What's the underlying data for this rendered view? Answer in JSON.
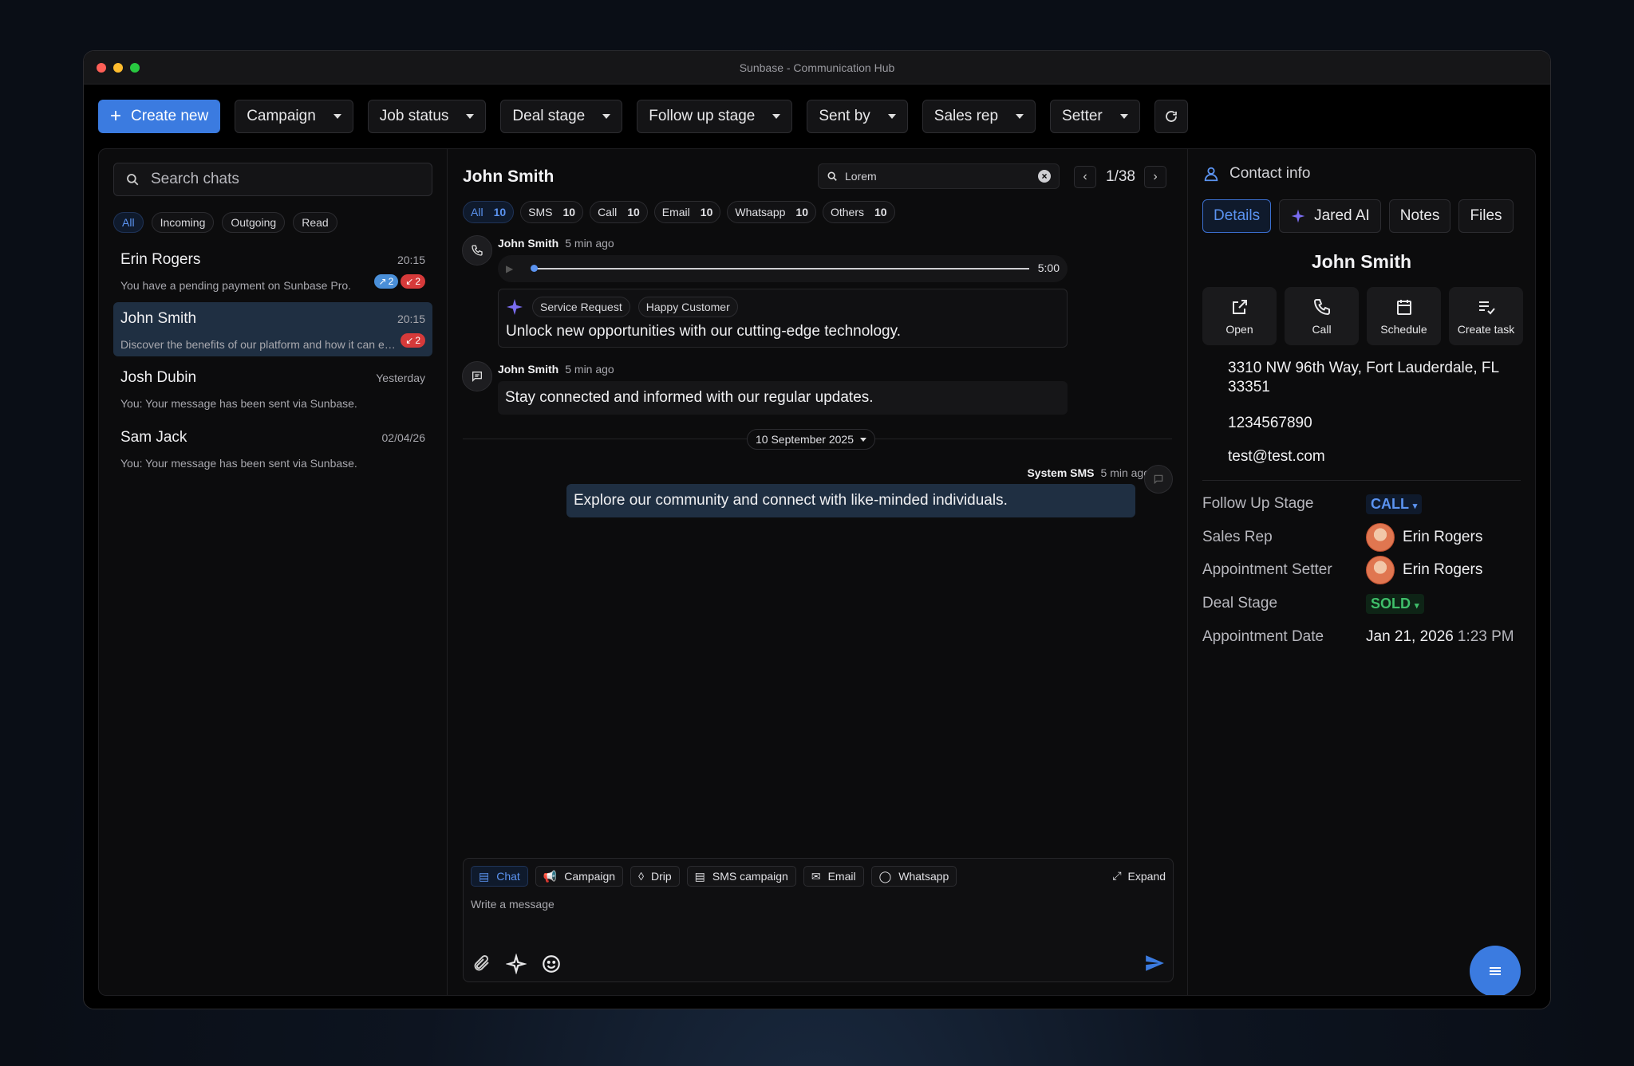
{
  "window": {
    "title": "Sunbase - Communication Hub"
  },
  "toolbar": {
    "create_label": "Create new",
    "dropdowns": [
      "Campaign",
      "Job status",
      "Deal stage",
      "Follow up stage",
      "Sent by",
      "Sales rep",
      "Setter"
    ]
  },
  "left": {
    "search_placeholder": "Search chats",
    "filters": [
      "All",
      "Incoming",
      "Outgoing",
      "Read"
    ],
    "chats": [
      {
        "name": "Erin Rogers",
        "time": "20:15",
        "preview": "You have a pending payment on Sunbase Pro.",
        "badge_blue": "2",
        "badge_red": "2"
      },
      {
        "name": "John Smith",
        "time": "20:15",
        "preview": "Discover the benefits of our platform and how it can enhance your workflow.",
        "badge_red": "2"
      },
      {
        "name": "Josh Dubin",
        "time": "Yesterday",
        "preview": "You: Your message has been sent via Sunbase."
      },
      {
        "name": "Sam Jack",
        "time": "02/04/26",
        "preview": "You: Your message has been sent via Sunbase."
      }
    ]
  },
  "center": {
    "contact_name": "John Smith",
    "search_value": "Lorem",
    "counter": "1/38",
    "tabs": [
      {
        "label": "All",
        "count": "10"
      },
      {
        "label": "SMS",
        "count": "10"
      },
      {
        "label": "Call",
        "count": "10"
      },
      {
        "label": "Email",
        "count": "10"
      },
      {
        "label": "Whatsapp",
        "count": "10"
      },
      {
        "label": "Others",
        "count": "10"
      }
    ],
    "messages": {
      "call": {
        "sender": "John Smith",
        "time": "5 min ago",
        "duration": "5:00",
        "tags": [
          "Service Request",
          "Happy Customer"
        ],
        "summary": "Unlock new opportunities with our cutting-edge technology."
      },
      "sms": {
        "sender": "John Smith",
        "time": "5 min ago",
        "text": "Stay connected and informed with our regular updates."
      },
      "date_divider": "10 September 2025",
      "system": {
        "sender": "System SMS",
        "time": "5 min ago",
        "text": "Explore our community and connect with like-minded individuals."
      }
    },
    "composer": {
      "tabs": [
        "Chat",
        "Campaign",
        "Drip",
        "SMS campaign",
        "Email",
        "Whatsapp"
      ],
      "expand_label": "Expand",
      "placeholder": "Write a message"
    }
  },
  "right": {
    "header": "Contact info",
    "tabs": [
      "Details",
      "Jared AI",
      "Notes",
      "Files"
    ],
    "name": "John Smith",
    "actions": [
      "Open",
      "Call",
      "Schedule",
      "Create task"
    ],
    "address": "3310 NW 96th Way, Fort Lauderdale, FL 33351",
    "phone": "1234567890",
    "email": "test@test.com",
    "fields": {
      "follow_up_label": "Follow Up Stage",
      "follow_up_value": "CALL",
      "sales_rep_label": "Sales Rep",
      "sales_rep_value": "Erin Rogers",
      "setter_label": "Appointment Setter",
      "setter_value": "Erin Rogers",
      "deal_label": "Deal Stage",
      "deal_value": "SOLD",
      "date_label": "Appointment Date",
      "date_value": "Jan 21, 2026",
      "time_value": "1:23 PM"
    }
  }
}
